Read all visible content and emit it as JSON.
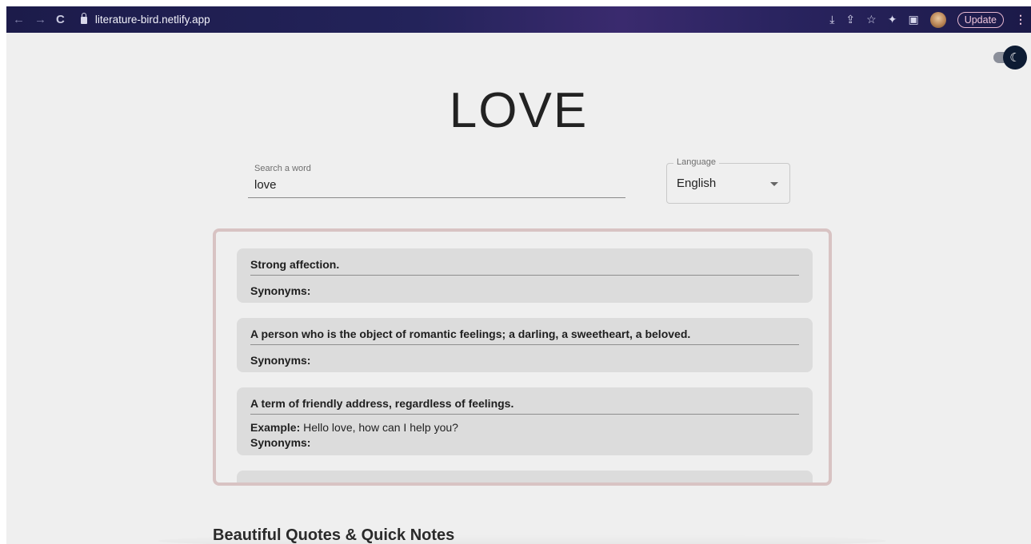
{
  "browser": {
    "back": "←",
    "forward": "→",
    "reload": "C",
    "url": "literature-bird.netlify.app",
    "update_label": "Update",
    "menu": "⋮"
  },
  "page": {
    "title": "LOVE",
    "search": {
      "label": "Search a word",
      "value": "love"
    },
    "language": {
      "legend": "Language",
      "value": "English"
    },
    "definitions": [
      {
        "text": "Strong affection.",
        "synonyms_label": "Synonyms:"
      },
      {
        "text": "A person who is the object of romantic feelings; a darling, a sweetheart, a beloved.",
        "synonyms_label": "Synonyms:"
      },
      {
        "text": "A term of friendly address, regardless of feelings.",
        "example_label": "Example:",
        "example": "Hello love, how can I help you?",
        "synonyms_label": "Synonyms:"
      }
    ],
    "section_heading": "Beautiful Quotes & Quick Notes"
  },
  "colors": {
    "page_bg": "#efefef",
    "card_bg": "#dcdcdc",
    "frame_border": "#d8c3c3",
    "toggle_knob": "#0d1b33"
  }
}
